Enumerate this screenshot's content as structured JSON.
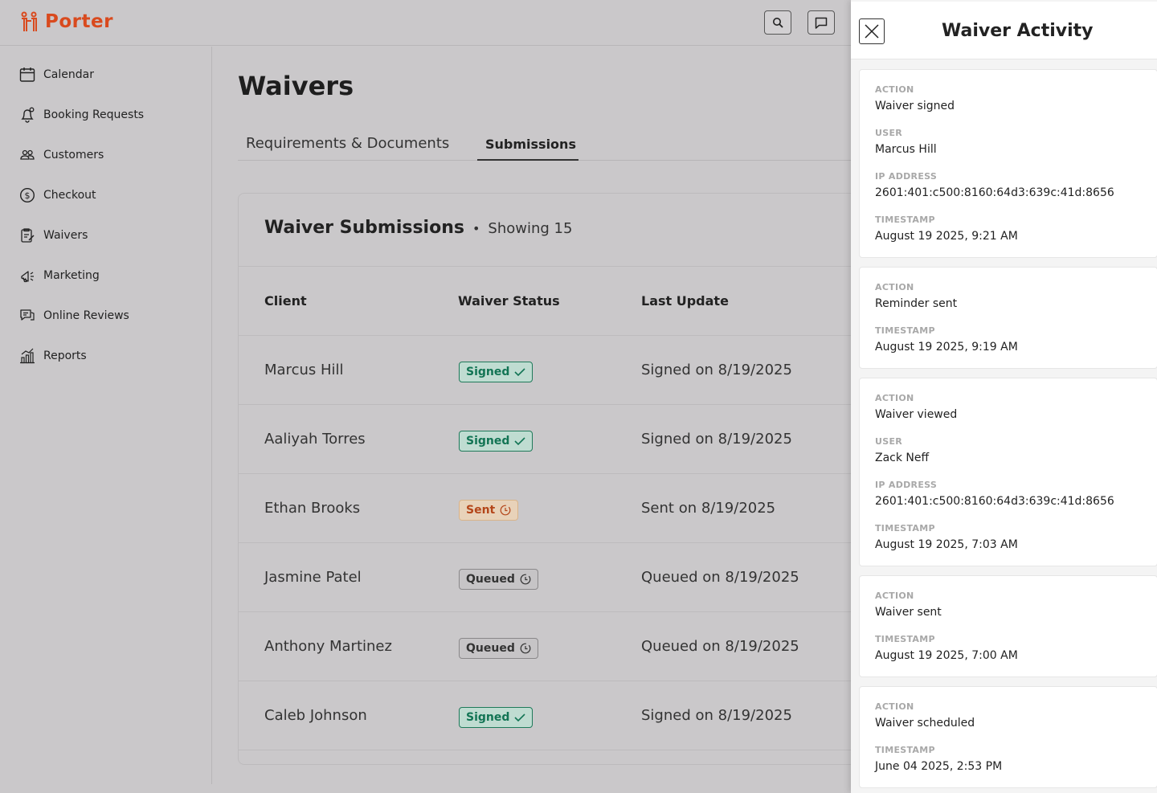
{
  "app": {
    "name": "Porter",
    "brand_color": "#d94a1e"
  },
  "topbar": {
    "icons": [
      "search-icon",
      "chat-icon"
    ]
  },
  "sidebar": {
    "items": [
      {
        "label": "Calendar",
        "icon": "calendar-icon"
      },
      {
        "label": "Booking Requests",
        "icon": "bell-icon"
      },
      {
        "label": "Customers",
        "icon": "users-icon"
      },
      {
        "label": "Checkout",
        "icon": "dollar-icon"
      },
      {
        "label": "Waivers",
        "icon": "clipboard-icon"
      },
      {
        "label": "Marketing",
        "icon": "megaphone-icon"
      },
      {
        "label": "Online Reviews",
        "icon": "reviews-icon"
      },
      {
        "label": "Reports",
        "icon": "bar-chart-icon"
      }
    ]
  },
  "main": {
    "title": "Waivers",
    "tabs": [
      {
        "label": "Requirements & Documents",
        "active": false
      },
      {
        "label": "Submissions",
        "active": true
      }
    ],
    "card": {
      "title": "Waiver Submissions",
      "separator": "•",
      "count": "Showing 15",
      "headers": {
        "client": "Client",
        "status": "Waiver Status",
        "last_update": "Last Update"
      },
      "rows": [
        {
          "client": "Marcus Hill",
          "status": "Signed",
          "status_type": "signed",
          "last_update": "Signed on 8/19/2025"
        },
        {
          "client": "Aaliyah Torres",
          "status": "Signed",
          "status_type": "signed",
          "last_update": "Signed on 8/19/2025"
        },
        {
          "client": "Ethan Brooks",
          "status": "Sent",
          "status_type": "sent",
          "last_update": "Sent on 8/19/2025"
        },
        {
          "client": "Jasmine Patel",
          "status": "Queued",
          "status_type": "queued",
          "last_update": "Queued on 8/19/2025"
        },
        {
          "client": "Anthony Martinez",
          "status": "Queued",
          "status_type": "queued",
          "last_update": "Queued on 8/19/2025"
        },
        {
          "client": "Caleb Johnson",
          "status": "Signed",
          "status_type": "signed",
          "last_update": "Signed on 8/19/2025"
        }
      ]
    }
  },
  "panel": {
    "title": "Waiver Activity",
    "labels": {
      "action": "ACTION",
      "user": "USER",
      "ip": "IP ADDRESS",
      "timestamp": "TIMESTAMP"
    },
    "activities": [
      {
        "action": "Waiver signed",
        "user": "Marcus Hill",
        "ip": "2601:401:c500:8160:64d3:639c:41d:8656",
        "timestamp": "August 19 2025, 9:21 AM"
      },
      {
        "action": "Reminder sent",
        "timestamp": "August 19 2025, 9:19 AM"
      },
      {
        "action": "Waiver viewed",
        "user": "Zack Neff",
        "ip": "2601:401:c500:8160:64d3:639c:41d:8656",
        "timestamp": "August 19 2025, 7:03 AM"
      },
      {
        "action": "Waiver sent",
        "timestamp": "August 19 2025, 7:00 AM"
      },
      {
        "action": "Waiver scheduled",
        "timestamp": "June 04 2025, 2:53 PM"
      }
    ]
  },
  "colors": {
    "signed": "#127454",
    "sent": "#b4461a",
    "queued": "#333333"
  }
}
